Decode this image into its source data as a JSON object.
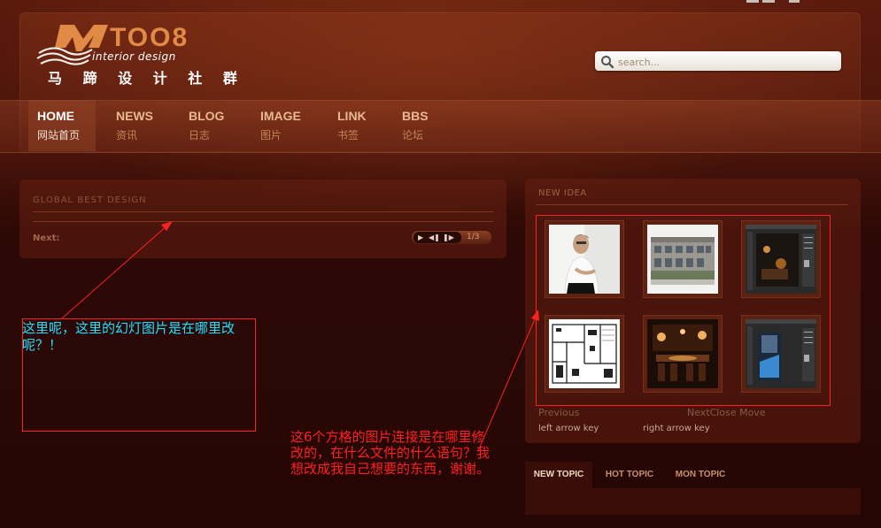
{
  "brand": {
    "logo_text": "MTOO8",
    "tagline": "interior design",
    "chinese_name": "马 蹄 设 计 社 群"
  },
  "search": {
    "placeholder": "search..."
  },
  "nav": {
    "items": [
      {
        "en": "HOME",
        "cn": "网站首页",
        "active": true
      },
      {
        "en": "NEWS",
        "cn": "资讯"
      },
      {
        "en": "BLOG",
        "cn": "日志"
      },
      {
        "en": "IMAGE",
        "cn": "图片"
      },
      {
        "en": "LINK",
        "cn": "书签"
      },
      {
        "en": "BBS",
        "cn": "论坛"
      }
    ]
  },
  "slideshow": {
    "title": "GLOBAL BEST DESIGN",
    "next_label": "Next:",
    "counter": "1/3"
  },
  "new_idea": {
    "title": "NEW IDEA",
    "previous": "Previous",
    "next_close_move": "NextClose Move",
    "left_hint": "left arrow key",
    "right_hint": "right arrow key"
  },
  "topic_tabs": {
    "tabs": [
      "NEW TOPIC",
      "HOT TOPIC",
      "MON TOPIC"
    ]
  },
  "annotations": {
    "slideshow_note": "这里呢，这里的幻灯图片是在哪里改呢？！",
    "thumbs_note": "这6个方格的图片连接是在哪里修改的，在什么文件的什么语句？我想改成我自己想要的东西，谢谢。"
  },
  "colors": {
    "background": "#2a0905",
    "accent_text": "#e8b890",
    "annotation_cyan": "#22e0ff",
    "annotation_red": "#ff2020"
  },
  "icons": [
    "search-icon",
    "play-icon",
    "prev-icon",
    "next-icon"
  ]
}
